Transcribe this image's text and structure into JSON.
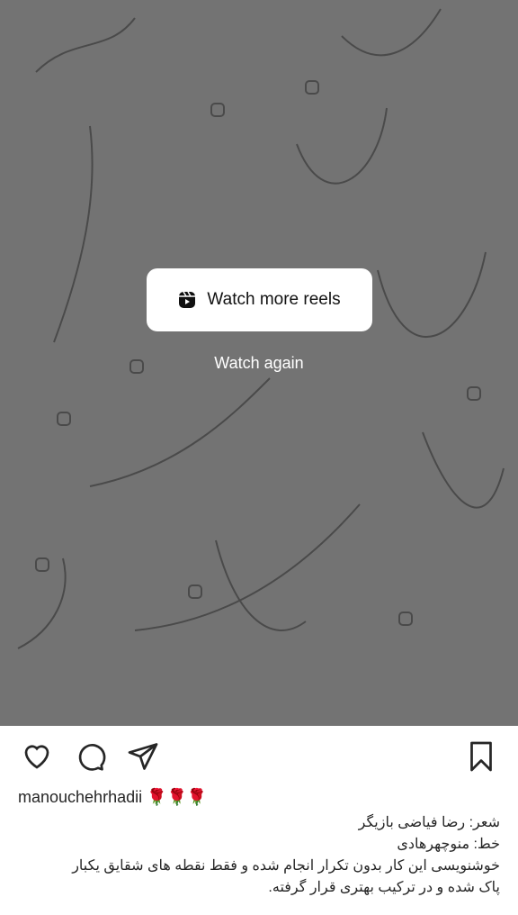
{
  "overlay": {
    "watch_more_label": "Watch more reels",
    "watch_again_label": "Watch again"
  },
  "post": {
    "username": "manouchehrhadii",
    "username_emoji": "🌹🌹🌹",
    "caption_lines": [
      "شعر: رضا فیاضی بازیگر",
      "خط: منوچهرهادی",
      "خوشنویسی این کار بدون تکرار انجام شده و فقط نقطه های شقایق یکبار",
      "پاک شده و در ترکیب بهتری قرار گرفته."
    ]
  },
  "colors": {
    "video_bg": "#737373",
    "text": "#262626"
  }
}
